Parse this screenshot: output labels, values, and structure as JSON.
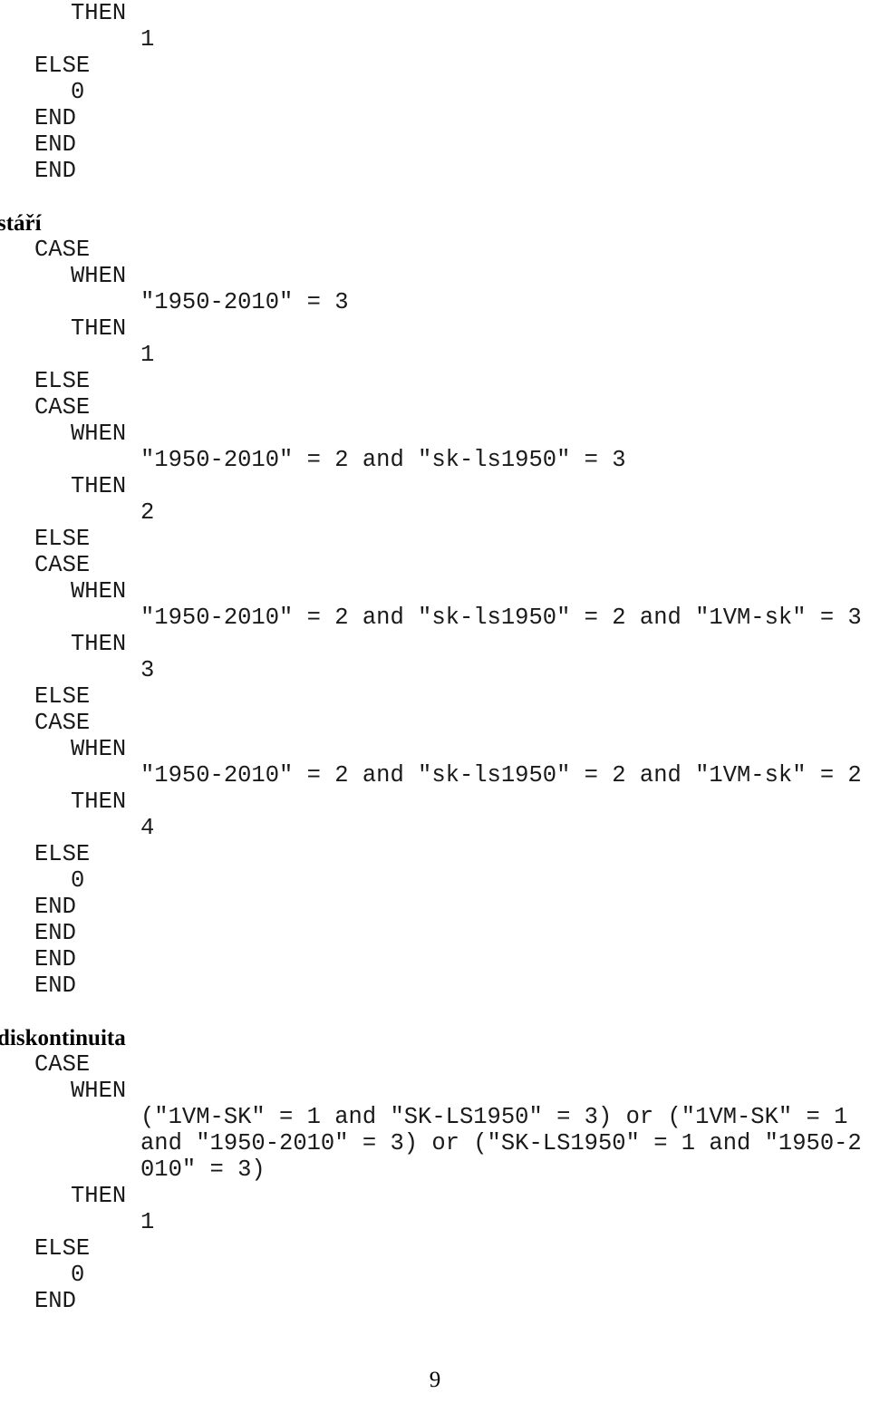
{
  "document": {
    "page_number": "9",
    "language": "cs"
  },
  "blocks": [
    {
      "kind": "code",
      "name": "code-block-continued",
      "lines": [
        {
          "indent": 2,
          "text": "THEN"
        },
        {
          "indent": 3,
          "text": "1"
        },
        {
          "indent": 1,
          "text": "ELSE"
        },
        {
          "indent": 2,
          "text": "0"
        },
        {
          "indent": 1,
          "text": "END"
        },
        {
          "indent": 1,
          "text": "END"
        },
        {
          "indent": 1,
          "text": "END"
        }
      ]
    },
    {
      "kind": "spacer",
      "name": "block-spacer-1"
    },
    {
      "kind": "heading",
      "name": "section-heading-stari",
      "text": "stáří"
    },
    {
      "kind": "code",
      "name": "code-block-stari",
      "lines": [
        {
          "indent": 1,
          "text": "CASE"
        },
        {
          "indent": 2,
          "text": "WHEN"
        },
        {
          "indent": 3,
          "text": "\"1950-2010\" = 3"
        },
        {
          "indent": 2,
          "text": "THEN"
        },
        {
          "indent": 3,
          "text": "1"
        },
        {
          "indent": 1,
          "text": "ELSE"
        },
        {
          "indent": 1,
          "text": "CASE"
        },
        {
          "indent": 2,
          "text": "WHEN"
        },
        {
          "indent": 3,
          "text": "\"1950-2010\" = 2 and \"sk-ls1950\" = 3"
        },
        {
          "indent": 2,
          "text": "THEN"
        },
        {
          "indent": 3,
          "text": "2"
        },
        {
          "indent": 1,
          "text": "ELSE"
        },
        {
          "indent": 1,
          "text": "CASE"
        },
        {
          "indent": 2,
          "text": "WHEN"
        },
        {
          "indent": 3,
          "text": "\"1950-2010\" = 2 and \"sk-ls1950\" = 2 and \"1VM-sk\" = 3"
        },
        {
          "indent": 2,
          "text": "THEN"
        },
        {
          "indent": 3,
          "text": "3"
        },
        {
          "indent": 1,
          "text": "ELSE"
        },
        {
          "indent": 1,
          "text": "CASE"
        },
        {
          "indent": 2,
          "text": "WHEN"
        },
        {
          "indent": 3,
          "text": "\"1950-2010\" = 2 and \"sk-ls1950\" = 2 and \"1VM-sk\" = 2"
        },
        {
          "indent": 2,
          "text": "THEN"
        },
        {
          "indent": 3,
          "text": "4"
        },
        {
          "indent": 1,
          "text": "ELSE"
        },
        {
          "indent": 2,
          "text": "0"
        },
        {
          "indent": 1,
          "text": "END"
        },
        {
          "indent": 1,
          "text": "END"
        },
        {
          "indent": 1,
          "text": "END"
        },
        {
          "indent": 1,
          "text": "END"
        }
      ]
    },
    {
      "kind": "spacer",
      "name": "block-spacer-2"
    },
    {
      "kind": "heading",
      "name": "section-heading-diskontinuita",
      "text": "diskontinuita"
    },
    {
      "kind": "code",
      "name": "code-block-diskontinuita",
      "lines": [
        {
          "indent": 1,
          "text": "CASE"
        },
        {
          "indent": 2,
          "text": "WHEN"
        },
        {
          "indent": 3,
          "wrap": true,
          "text": "(\"1VM-SK\" = 1 and \"SK-LS1950\" = 3) or (\"1VM-SK\" = 1 and \"1950-2010\" = 3) or (\"SK-LS1950\" = 1 and \"1950-2010\" = 3)"
        },
        {
          "indent": 2,
          "text": "THEN"
        },
        {
          "indent": 3,
          "text": "1"
        },
        {
          "indent": 1,
          "text": "ELSE"
        },
        {
          "indent": 2,
          "text": "0"
        },
        {
          "indent": 1,
          "text": "END"
        }
      ]
    }
  ]
}
